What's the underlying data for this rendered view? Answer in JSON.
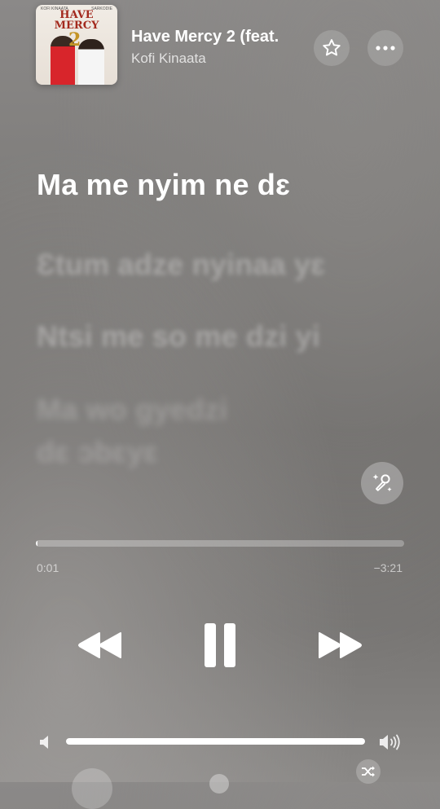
{
  "now_playing": {
    "title": "Have Mercy 2 (feat.",
    "artist": "Kofi Kinaata",
    "artwork": {
      "title_line1": "HAVE",
      "title_line2": "MERCY",
      "number": "2",
      "caption_left": "KOFI KINAATA",
      "caption_right": "SARKODIE"
    }
  },
  "header_buttons": {
    "favorite_icon": "star-icon",
    "more_icon": "ellipsis-icon"
  },
  "lyrics": {
    "active_line": "Ma me nyim ne dɛ",
    "upcoming_lines": [
      "Ɛtum adze nyinaa yɛ",
      "Ntsi me so me dzi yi",
      "Ma wo gyedzi",
      "dɛ ɔbɛyɛ"
    ]
  },
  "sing_button_icon": "microphone-sparkle-icon",
  "playback": {
    "elapsed": "0:01",
    "remaining": "−3:21",
    "progress_fraction": 0.004
  },
  "controls": {
    "previous_icon": "rewind-icon",
    "pause_icon": "pause-icon",
    "next_icon": "fast-forward-icon"
  },
  "volume": {
    "low_icon": "speaker-low-icon",
    "high_icon": "speaker-high-icon",
    "level_fraction": 1.0
  },
  "bottom": {
    "shuffle_icon": "shuffle-icon"
  }
}
